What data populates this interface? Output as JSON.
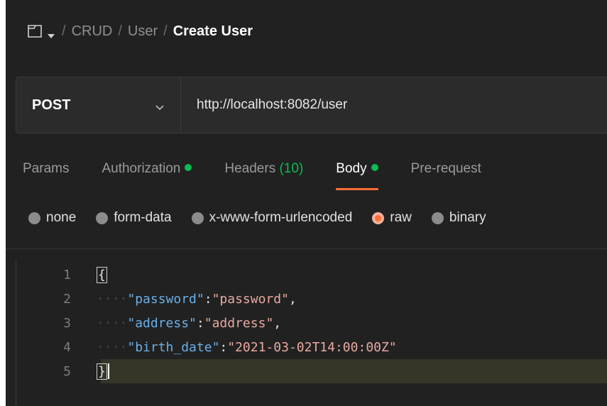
{
  "breadcrumb": {
    "items": [
      "CRUD",
      "User"
    ],
    "current": "Create User",
    "separator": "/"
  },
  "request": {
    "method": "POST",
    "url": "http://localhost:8082/user"
  },
  "tabs": [
    {
      "label": "Params",
      "count": "",
      "dot": false,
      "active": false
    },
    {
      "label": "Authorization",
      "count": "",
      "dot": true,
      "active": false
    },
    {
      "label": "Headers",
      "count": "(10)",
      "dot": false,
      "active": false
    },
    {
      "label": "Body",
      "count": "",
      "dot": true,
      "active": true
    },
    {
      "label": "Pre-request",
      "count": "",
      "dot": false,
      "active": false
    }
  ],
  "body_types": [
    {
      "label": "none",
      "checked": false
    },
    {
      "label": "form-data",
      "checked": false
    },
    {
      "label": "x-www-form-urlencoded",
      "checked": false
    },
    {
      "label": "raw",
      "checked": true
    },
    {
      "label": "binary",
      "checked": false
    }
  ],
  "editor": {
    "lines": [
      {
        "n": "1",
        "key": "",
        "value": "",
        "brace": "{"
      },
      {
        "n": "2",
        "key": "\"password\"",
        "value": "\"password\"",
        "brace": ""
      },
      {
        "n": "3",
        "key": "\"address\"",
        "value": "\"address\"",
        "brace": ""
      },
      {
        "n": "4",
        "key": "\"birth_date\"",
        "value": "\"2021-03-02T14:00:00Z\"",
        "brace": ""
      },
      {
        "n": "5",
        "key": "",
        "value": "",
        "brace": "}"
      }
    ],
    "indent": "····",
    "colon": ":",
    "comma": ","
  },
  "colors": {
    "accent": "#ff6c37",
    "status_dot": "#0cbb52",
    "json_key": "#6ab0e8",
    "json_string": "#e8a9a0"
  },
  "icons": {
    "collection": "collection-icon",
    "dropdown": "chevron-down-icon"
  }
}
